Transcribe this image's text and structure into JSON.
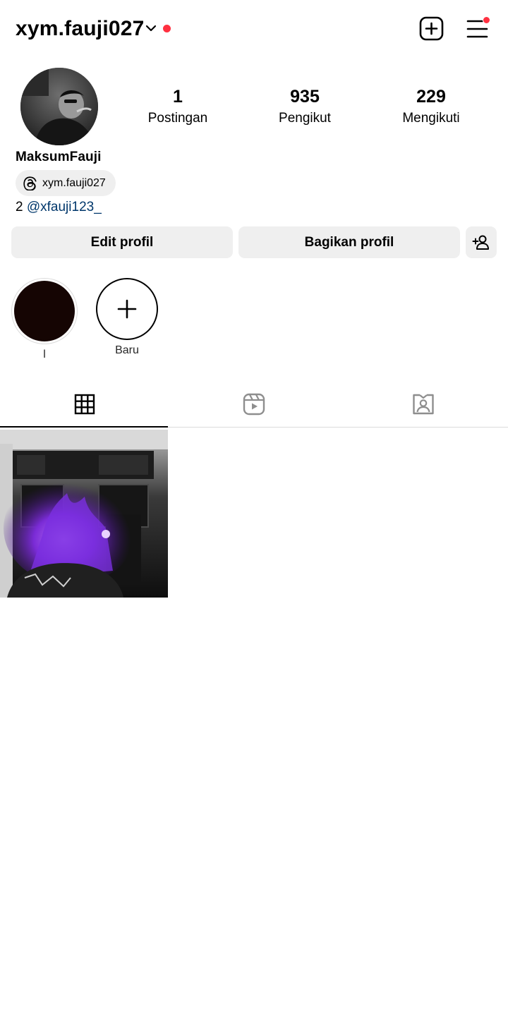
{
  "header": {
    "username": "xym.fauji027",
    "has_notification_dot": true,
    "icons": [
      "chevron-down-icon",
      "new-post-icon",
      "menu-icon"
    ]
  },
  "profile": {
    "display_name": "MaksumFauji",
    "threads_handle": "xym.fauji027",
    "bio_prefix": "2",
    "bio_mention": "@xfauji123_"
  },
  "stats": [
    {
      "value": "1",
      "label": "Postingan"
    },
    {
      "value": "935",
      "label": "Pengikut"
    },
    {
      "value": "229",
      "label": "Mengikuti"
    }
  ],
  "actions": {
    "edit_label": "Edit profil",
    "share_label": "Bagikan profil",
    "discover_icon": "add-person-icon"
  },
  "highlights": [
    {
      "label": "l"
    },
    {
      "label": "Baru"
    }
  ],
  "tabs": [
    {
      "icon": "grid-icon",
      "active": true
    },
    {
      "icon": "reels-icon",
      "active": false
    },
    {
      "icon": "tagged-icon",
      "active": false
    }
  ],
  "colors": {
    "notification": "#ff3040",
    "mention": "#00376b",
    "button_bg": "#efefef",
    "inactive_icon": "#8e8e8e"
  }
}
